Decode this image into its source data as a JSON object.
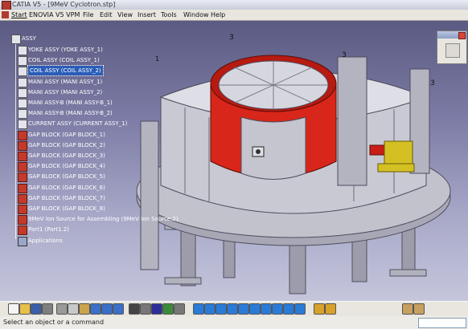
{
  "window": {
    "title": "CATIA V5 - [9MeV Cyclotron.stp]"
  },
  "menu": [
    "Start",
    "ENOVIA V5 VPM",
    "File",
    "Edit",
    "View",
    "Insert",
    "Tools",
    "Window",
    "Help"
  ],
  "tree": {
    "root": "ASSY",
    "items": [
      {
        "label": "YOKE ASSY (YOKE ASSY_1)",
        "icon": "product-icon",
        "selected": false
      },
      {
        "label": "COIL ASSY (COIL ASSY_1)",
        "icon": "product-icon",
        "selected": false
      },
      {
        "label": "COIL ASSY (COIL ASSY_2)",
        "icon": "product-icon",
        "selected": true
      },
      {
        "label": "MANI ASSY (MANI ASSY_1)",
        "icon": "product-icon",
        "selected": false
      },
      {
        "label": "MANI ASSY (MANI ASSY_2)",
        "icon": "product-icon",
        "selected": false
      },
      {
        "label": "MANI ASSY-B (MANI ASSY-B_1)",
        "icon": "product-icon",
        "selected": false
      },
      {
        "label": "MANI ASSY-B (MANI ASSY-B_2)",
        "icon": "product-icon",
        "selected": false
      },
      {
        "label": "CURRENT ASSY (CURRENT ASSY_1)",
        "icon": "product-icon",
        "selected": false
      },
      {
        "label": "GAP BLOCK (GAP BLOCK_1)",
        "icon": "part-icon",
        "selected": false
      },
      {
        "label": "GAP BLOCK (GAP BLOCK_2)",
        "icon": "part-icon",
        "selected": false
      },
      {
        "label": "GAP BLOCK (GAP BLOCK_3)",
        "icon": "part-icon",
        "selected": false
      },
      {
        "label": "GAP BLOCK (GAP BLOCK_4)",
        "icon": "part-icon",
        "selected": false
      },
      {
        "label": "GAP BLOCK (GAP BLOCK_5)",
        "icon": "part-icon",
        "selected": false
      },
      {
        "label": "GAP BLOCK (GAP BLOCK_6)",
        "icon": "part-icon",
        "selected": false
      },
      {
        "label": "GAP BLOCK (GAP BLOCK_7)",
        "icon": "part-icon",
        "selected": false
      },
      {
        "label": "GAP BLOCK (GAP BLOCK_8)",
        "icon": "part-icon",
        "selected": false
      },
      {
        "label": "9MeV Ion Source for Assembling (9MeV Ion Source.2)",
        "icon": "part-icon",
        "selected": false
      },
      {
        "label": "Part1 (Part1.2)",
        "icon": "part-icon",
        "selected": false
      },
      {
        "label": "Applications",
        "icon": "applications-icon",
        "selected": false
      }
    ]
  },
  "status": {
    "message": "Select an object or a command",
    "command_value": ""
  },
  "colors": {
    "coil": "#d8261a",
    "yoke": "#c8c8d2",
    "ion_source": "#d4c023",
    "selection": "#2a5db7",
    "background_top": "#5a5a82",
    "background_bottom": "#c5c6dc"
  }
}
